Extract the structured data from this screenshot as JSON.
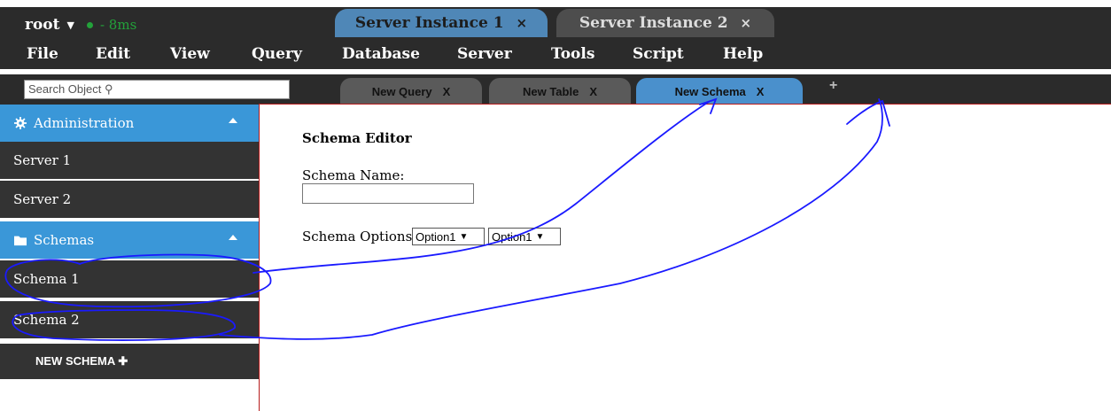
{
  "header": {
    "user": "root",
    "user_caret": "▼",
    "ping": "- 8ms",
    "server_tabs": [
      {
        "label": "Server Instance 1",
        "close": "×"
      },
      {
        "label": "Server Instance 2",
        "close": "×"
      }
    ]
  },
  "menu": [
    "File",
    "Edit",
    "View",
    "Query",
    "Database",
    "Server",
    "Tools",
    "Script",
    "Help"
  ],
  "toolbar": {
    "search_placeholder": "Search Object ⚲",
    "tabs": [
      {
        "label": "New Query",
        "close": "X"
      },
      {
        "label": "New Table",
        "close": "X"
      },
      {
        "label": "New Schema",
        "close": "X"
      }
    ],
    "add": "+"
  },
  "sidebar": {
    "admin_header": "Administration",
    "servers": [
      "Server 1",
      "Server 2"
    ],
    "schemas_header": "Schemas",
    "schemas": [
      "Schema 1",
      "Schema 2"
    ],
    "new_schema": "NEW SCHEMA ✚"
  },
  "editor": {
    "title": "Schema Editor",
    "name_label": "Schema Name:",
    "name_value": "",
    "options_label": "Schema Options",
    "option_1": "Option1",
    "option_2": "Option1"
  },
  "colors": {
    "accent_blue": "#3a97d8",
    "dark_bar": "#2b2b2b",
    "annotation": "#1a1aff"
  }
}
